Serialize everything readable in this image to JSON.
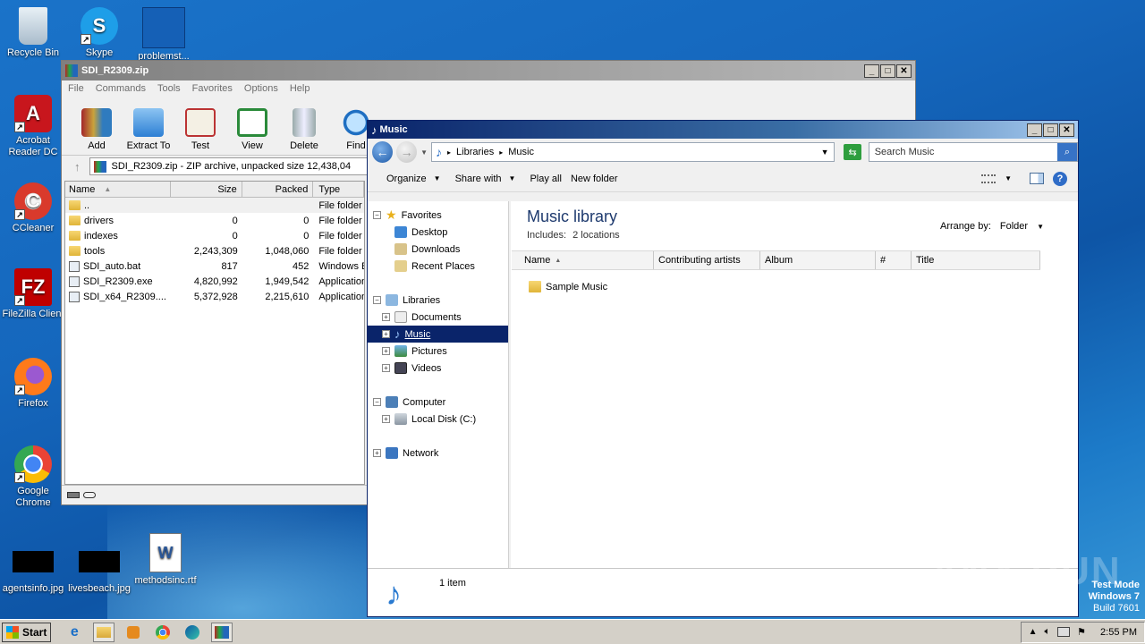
{
  "desktop": {
    "icons": [
      {
        "label": "Recycle Bin"
      },
      {
        "label": "Skype"
      },
      {
        "label": "problemst..."
      },
      {
        "label": "Acrobat Reader DC"
      },
      {
        "label": "CCleaner"
      },
      {
        "label": "FileZilla Client"
      },
      {
        "label": "Firefox"
      },
      {
        "label": "Google Chrome"
      },
      {
        "label": "agentsinfo.jpg"
      },
      {
        "label": "livesbeach.jpg"
      },
      {
        "label": "methodsinc.rtf"
      }
    ],
    "watermark": {
      "line1": "Test Mode",
      "line2": "Windows 7",
      "line3": "Build 7601"
    },
    "brand": "ANY RUN"
  },
  "winrar": {
    "title": "SDI_R2309.zip",
    "menu": [
      "File",
      "Commands",
      "Tools",
      "Favorites",
      "Options",
      "Help"
    ],
    "tools": [
      "Add",
      "Extract To",
      "Test",
      "View",
      "Delete",
      "Find"
    ],
    "address": "SDI_R2309.zip - ZIP archive, unpacked size 12,438,04",
    "columns": [
      "Name",
      "Size",
      "Packed",
      "Type"
    ],
    "files": [
      {
        "name": "..",
        "size": "",
        "packed": "",
        "type": "File folder"
      },
      {
        "name": "drivers",
        "size": "0",
        "packed": "0",
        "type": "File folder"
      },
      {
        "name": "indexes",
        "size": "0",
        "packed": "0",
        "type": "File folder"
      },
      {
        "name": "tools",
        "size": "2,243,309",
        "packed": "1,048,060",
        "type": "File folder"
      },
      {
        "name": "SDI_auto.bat",
        "size": "817",
        "packed": "452",
        "type": "Windows B"
      },
      {
        "name": "SDI_R2309.exe",
        "size": "4,820,992",
        "packed": "1,949,542",
        "type": "Application"
      },
      {
        "name": "SDI_x64_R2309....",
        "size": "5,372,928",
        "packed": "2,215,610",
        "type": "Application"
      }
    ]
  },
  "explorer": {
    "title": "Music",
    "breadcrumb": [
      "Libraries",
      "Music"
    ],
    "search_placeholder": "Search Music",
    "commands": [
      "Organize",
      "Share with",
      "Play all",
      "New folder"
    ],
    "nav": {
      "favorites": "Favorites",
      "favorites_items": [
        "Desktop",
        "Downloads",
        "Recent Places"
      ],
      "libraries": "Libraries",
      "libraries_items": [
        "Documents",
        "Music",
        "Pictures",
        "Videos"
      ],
      "computer": "Computer",
      "computer_items": [
        "Local Disk (C:)"
      ],
      "network": "Network"
    },
    "library_title": "Music library",
    "includes_label": "Includes:",
    "includes_value": "2 locations",
    "arrange_label": "Arrange by:",
    "arrange_value": "Folder",
    "columns": [
      "Name",
      "Contributing artists",
      "Album",
      "#",
      "Title"
    ],
    "items": [
      "Sample Music"
    ],
    "details": "1 item"
  },
  "taskbar": {
    "start": "Start",
    "time": "2:55 PM"
  }
}
